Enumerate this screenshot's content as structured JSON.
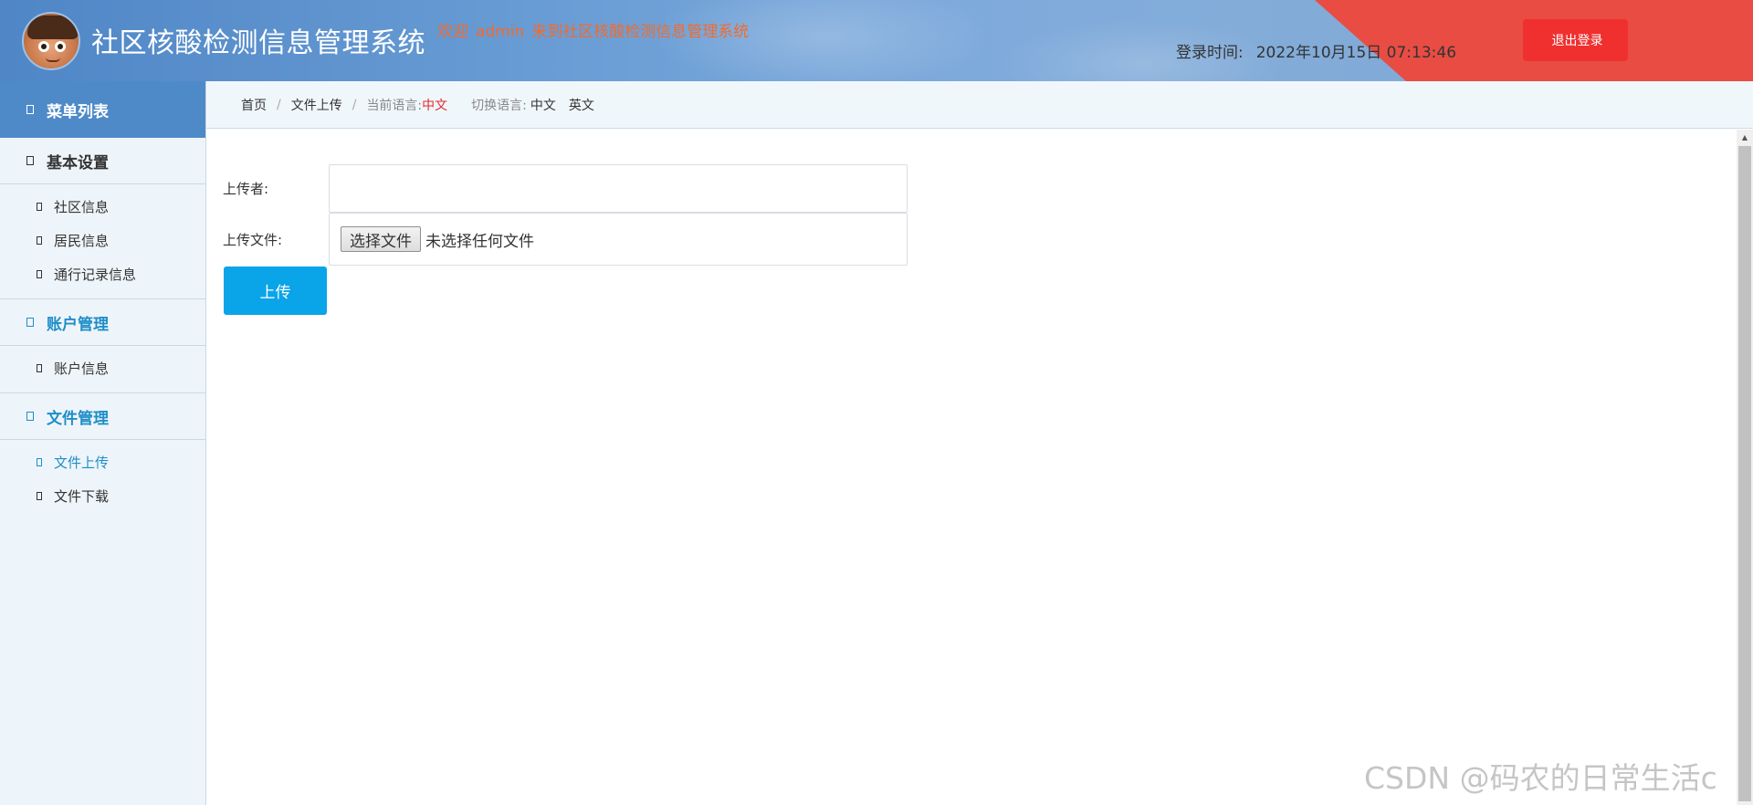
{
  "header": {
    "title": "社区核酸检测信息管理系统",
    "welcome_prefix": "欢迎",
    "welcome_user": "admin",
    "welcome_suffix": "来到社区核酸检测信息管理系统",
    "login_time_label": "登录时间:",
    "login_time_value": "2022年10月15日 07:13:46",
    "logout_icon": "",
    "logout_label": "退出登录"
  },
  "sidebar": {
    "heading": "菜单列表",
    "groups": [
      {
        "label": "基本设置",
        "items": [
          "社区信息",
          "居民信息",
          "通行记录信息"
        ]
      },
      {
        "label": "账户管理",
        "items": [
          "账户信息"
        ]
      },
      {
        "label": "文件管理",
        "items": [
          "文件上传",
          "文件下载"
        ]
      }
    ]
  },
  "breadcrumb": {
    "home_icon": "",
    "home": "首页",
    "separator": "/",
    "current": "文件上传",
    "lang_current_label": "当前语言:",
    "lang_current_value": "中文",
    "lang_switch_label": "切换语言:",
    "lang_options": [
      "中文",
      "英文"
    ]
  },
  "form": {
    "uploader_label": "上传者:",
    "uploader_value": "",
    "file_label": "上传文件:",
    "file_button": "选择文件",
    "file_status": "未选择任何文件",
    "submit_label": "上传"
  },
  "scrollbar": {
    "up_arrow": "▲"
  },
  "watermark": "CSDN @码农的日常生活c",
  "colors": {
    "header_blue": "#5b8fcf",
    "header_red": "#e84c43",
    "logout_red": "#f0302f",
    "welcome_orange": "#f26b2d",
    "active_blue": "#1f8ec8",
    "upload_blue": "#0aa4e8",
    "lang_red": "#e32b2b"
  }
}
